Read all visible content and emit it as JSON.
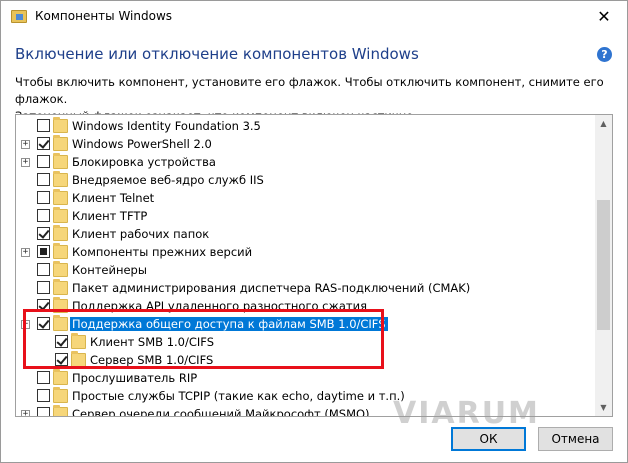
{
  "window": {
    "title": "Компоненты Windows",
    "close_glyph": "✕"
  },
  "header": {
    "title": "Включение или отключение компонентов Windows",
    "help_glyph": "?",
    "description_line1": "Чтобы включить компонент, установите его флажок. Чтобы отключить компонент, снимите его флажок.",
    "description_line2": "Затененный флажок означает, что компонент включен частично."
  },
  "tree": {
    "items": [
      {
        "label": "Windows Identity Foundation 3.5",
        "level": 0,
        "expandable": false,
        "state": "unchecked",
        "selected": false
      },
      {
        "label": "Windows PowerShell 2.0",
        "level": 0,
        "expandable": true,
        "state": "checked",
        "selected": false
      },
      {
        "label": "Блокировка устройства",
        "level": 0,
        "expandable": true,
        "state": "unchecked",
        "selected": false
      },
      {
        "label": "Внедряемое веб-ядро служб IIS",
        "level": 0,
        "expandable": false,
        "state": "unchecked",
        "selected": false
      },
      {
        "label": "Клиент Telnet",
        "level": 0,
        "expandable": false,
        "state": "unchecked",
        "selected": false
      },
      {
        "label": "Клиент TFTP",
        "level": 0,
        "expandable": false,
        "state": "unchecked",
        "selected": false
      },
      {
        "label": "Клиент рабочих папок",
        "level": 0,
        "expandable": false,
        "state": "checked",
        "selected": false
      },
      {
        "label": "Компоненты прежних версий",
        "level": 0,
        "expandable": true,
        "state": "partial",
        "selected": false
      },
      {
        "label": "Контейнеры",
        "level": 0,
        "expandable": false,
        "state": "unchecked",
        "selected": false
      },
      {
        "label": "Пакет администрирования диспетчера RAS-подключений (CMAK)",
        "level": 0,
        "expandable": false,
        "state": "unchecked",
        "selected": false
      },
      {
        "label": "Поддержка API удаленного разностного сжатия",
        "level": 0,
        "expandable": false,
        "state": "checked",
        "selected": false
      },
      {
        "label": "Поддержка общего доступа к файлам SMB 1.0/CIFS",
        "level": 0,
        "expandable": true,
        "state": "checked",
        "selected": true
      },
      {
        "label": "Клиент SMB 1.0/CIFS",
        "level": 1,
        "expandable": false,
        "state": "checked",
        "selected": false
      },
      {
        "label": "Сервер SMB 1.0/CIFS",
        "level": 1,
        "expandable": false,
        "state": "checked",
        "selected": false
      },
      {
        "label": "Прослушиватель RIP",
        "level": 0,
        "expandable": false,
        "state": "unchecked",
        "selected": false
      },
      {
        "label": "Простые службы TCPIP (такие как echo, daytime и т.п.)",
        "level": 0,
        "expandable": false,
        "state": "unchecked",
        "selected": false
      },
      {
        "label": "Сервер очереди сообщений Майкрософт (MSMQ)",
        "level": 0,
        "expandable": true,
        "state": "unchecked",
        "selected": false
      }
    ]
  },
  "scrollbar": {
    "up_glyph": "▲",
    "down_glyph": "▼"
  },
  "watermark": "VIARUM",
  "buttons": {
    "ok": "ОК",
    "cancel": "Отмена"
  },
  "colors": {
    "heading": "#1e3f8a",
    "selection": "#0078d7",
    "highlight_border": "#e8101a",
    "folder": "#f6d67a"
  }
}
